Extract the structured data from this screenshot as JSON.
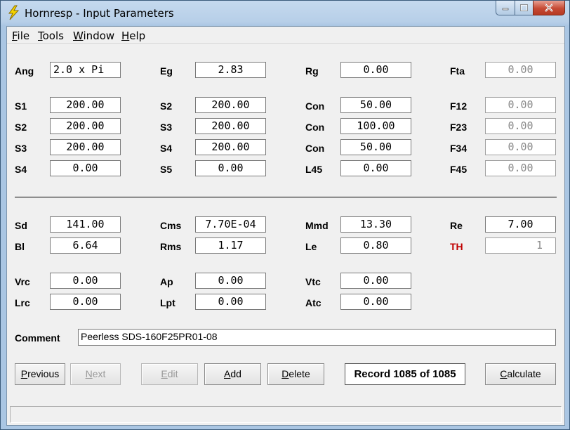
{
  "window": {
    "title": "Hornresp - Input Parameters"
  },
  "menu": {
    "file": {
      "hot": "F",
      "rest": "ile"
    },
    "tools": {
      "hot": "T",
      "rest": "ools"
    },
    "window": {
      "hot": "W",
      "rest": "indow"
    },
    "help": {
      "hot": "H",
      "rest": "elp"
    }
  },
  "top_params": {
    "ang": {
      "label": "Ang",
      "value": "2.0 x Pi"
    },
    "eg": {
      "label": "Eg",
      "value": "2.83"
    },
    "rg": {
      "label": "Rg",
      "value": "0.00"
    },
    "fta": {
      "label": "Fta",
      "value": "0.00"
    }
  },
  "horn_rows": [
    {
      "a_label": "S1",
      "a_value": "200.00",
      "b_label": "S2",
      "b_value": "200.00",
      "c_label": "Con",
      "c_value": "50.00",
      "d_label": "F12",
      "d_value": "0.00"
    },
    {
      "a_label": "S2",
      "a_value": "200.00",
      "b_label": "S3",
      "b_value": "200.00",
      "c_label": "Con",
      "c_value": "100.00",
      "d_label": "F23",
      "d_value": "0.00"
    },
    {
      "a_label": "S3",
      "a_value": "200.00",
      "b_label": "S4",
      "b_value": "200.00",
      "c_label": "Con",
      "c_value": "50.00",
      "d_label": "F34",
      "d_value": "0.00"
    },
    {
      "a_label": "S4",
      "a_value": "0.00",
      "b_label": "S5",
      "b_value": "0.00",
      "c_label": "L45",
      "c_value": "0.00",
      "d_label": "F45",
      "d_value": "0.00"
    }
  ],
  "driver": {
    "sd": {
      "label": "Sd",
      "value": "141.00"
    },
    "cms": {
      "label": "Cms",
      "value": "7.70E-04"
    },
    "mmd": {
      "label": "Mmd",
      "value": "13.30"
    },
    "re": {
      "label": "Re",
      "value": "7.00"
    },
    "bl": {
      "label": "Bl",
      "value": "6.64"
    },
    "rms": {
      "label": "Rms",
      "value": "1.17"
    },
    "le": {
      "label": "Le",
      "value": "0.80"
    },
    "th": {
      "label": "TH",
      "value": "1"
    }
  },
  "chambers": {
    "vrc": {
      "label": "Vrc",
      "value": "0.00"
    },
    "ap": {
      "label": "Ap",
      "value": "0.00"
    },
    "vtc": {
      "label": "Vtc",
      "value": "0.00"
    },
    "lrc": {
      "label": "Lrc",
      "value": "0.00"
    },
    "lpt": {
      "label": "Lpt",
      "value": "0.00"
    },
    "atc": {
      "label": "Atc",
      "value": "0.00"
    }
  },
  "comment": {
    "label": "Comment",
    "value": "Peerless SDS-160F25PR01-08"
  },
  "buttons": {
    "previous": {
      "hot": "P",
      "rest": "revious"
    },
    "next": {
      "hot": "N",
      "rest": "ext"
    },
    "edit": {
      "hot": "E",
      "rest": "dit"
    },
    "add": {
      "hot": "A",
      "rest": "dd"
    },
    "delete": {
      "hot": "D",
      "rest": "elete"
    },
    "calculate": {
      "hot": "C",
      "rest": "alculate"
    }
  },
  "record": "Record 1085 of 1085",
  "colors": {
    "th_label": "#c00000",
    "readonly_text": "#8a8a8a"
  },
  "icons": {
    "app": "lightning-bolt-icon"
  }
}
